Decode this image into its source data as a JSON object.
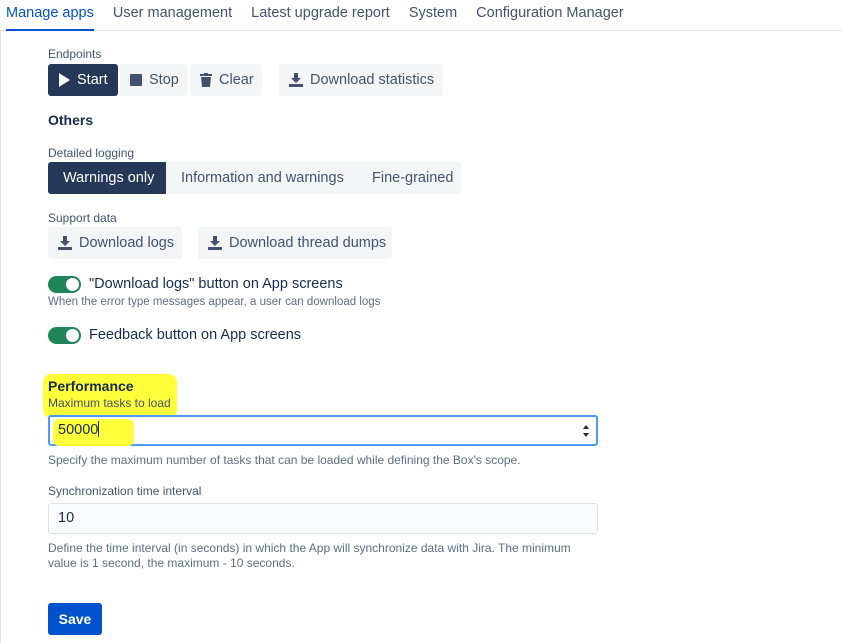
{
  "tabs": [
    {
      "label": "Manage apps"
    },
    {
      "label": "User management"
    },
    {
      "label": "Latest upgrade report"
    },
    {
      "label": "System"
    },
    {
      "label": "Configuration Manager"
    }
  ],
  "endpoints": {
    "label": "Endpoints",
    "start": "Start",
    "stop": "Stop",
    "clear": "Clear",
    "download_statistics": "Download statistics"
  },
  "others": {
    "title": "Others",
    "logging_label": "Detailed logging",
    "logging_options": [
      "Warnings only",
      "Information and warnings",
      "Fine-grained"
    ],
    "logging_selected": "Warnings only",
    "support_label": "Support data",
    "download_logs": "Download logs",
    "download_thread_dumps": "Download thread dumps",
    "toggle_download_logs": {
      "label": "\"Download logs\" button on App screens",
      "help": "When the error type messages appear, a user can download logs",
      "on": true
    },
    "toggle_feedback": {
      "label": "Feedback button on App screens",
      "on": true
    }
  },
  "performance": {
    "title": "Performance",
    "max_tasks_label": "Maximum tasks to load",
    "max_tasks_value": "50000",
    "max_tasks_help": "Specify the maximum number of tasks that can be loaded while defining the Box's scope.",
    "sync_label": "Synchronization time interval",
    "sync_value": "10",
    "sync_help_1": "Define the time interval (in seconds) in which the App will synchronize data with Jira. The minimum",
    "sync_help_2": "value is 1 second, the maximum - 10 seconds."
  },
  "save_label": "Save",
  "colors": {
    "highlight": "#ffff3a",
    "primary": "#0052cc",
    "toggle_on": "#1f845a",
    "dark_button": "#253858"
  }
}
